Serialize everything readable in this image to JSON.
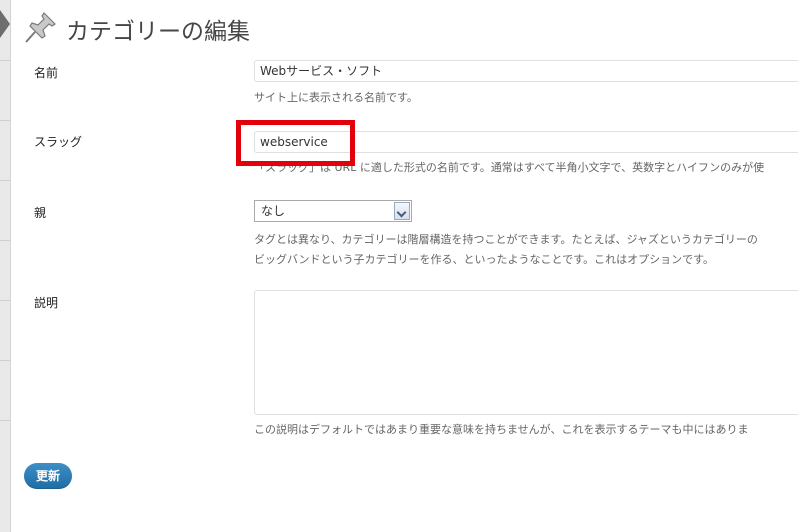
{
  "page": {
    "title": "カテゴリーの編集"
  },
  "fields": {
    "name": {
      "label": "名前",
      "value": "Webサービス・ソフト",
      "help": "サイト上に表示される名前です。"
    },
    "slug": {
      "label": "スラッグ",
      "value": "webservice",
      "help": "「スラッグ」は URL に適した形式の名前です。通常はすべて半角小文字で、英数字とハイフンのみが使"
    },
    "parent": {
      "label": "親",
      "selected": "なし",
      "help_line1": "タグとは異なり、カテゴリーは階層構造を持つことができます。たとえば、ジャズというカテゴリーの",
      "help_line2": "ビッグバンドという子カテゴリーを作る、といったようなことです。これはオプションです。"
    },
    "description": {
      "label": "説明",
      "value": "",
      "help": "この説明はデフォルトではあまり重要な意味を持ちませんが、これを表示するテーマも中にはありま"
    }
  },
  "actions": {
    "update_label": "更新"
  },
  "colors": {
    "highlight": "#e3000b",
    "button": "#2a7ab5"
  }
}
